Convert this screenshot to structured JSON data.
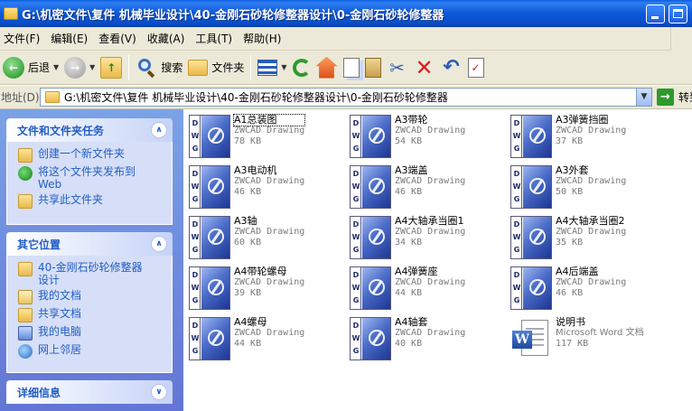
{
  "window": {
    "title": "G:\\机密文件\\复件 机械毕业设计\\40-金刚石砂轮修整器设计\\0-金刚石砂轮修整器"
  },
  "menu": [
    {
      "label": "文件(F)"
    },
    {
      "label": "编辑(E)"
    },
    {
      "label": "查看(V)"
    },
    {
      "label": "收藏(A)"
    },
    {
      "label": "工具(T)"
    },
    {
      "label": "帮助(H)"
    }
  ],
  "toolbar": {
    "back_label": "后退",
    "search_label": "搜索",
    "folders_label": "文件夹"
  },
  "address": {
    "label": "地址(D)",
    "value": "G:\\机密文件\\复件 机械毕业设计\\40-金刚石砂轮修整器设计\\0-金刚石砂轮修整器",
    "go_label": "转到"
  },
  "tasks_panel": {
    "title": "文件和文件夹任务",
    "items": [
      {
        "label": "创建一个新文件夹",
        "icon": "new-folder-icon"
      },
      {
        "label": "将这个文件夹发布到 Web",
        "icon": "web-publish-icon"
      },
      {
        "label": "共享此文件夹",
        "icon": "share-folder-icon"
      }
    ]
  },
  "places_panel": {
    "title": "其它位置",
    "items": [
      {
        "label": "40-金刚石砂轮修整器设计",
        "icon": "folder-icon"
      },
      {
        "label": "我的文档",
        "icon": "my-documents-icon"
      },
      {
        "label": "共享文档",
        "icon": "shared-documents-icon"
      },
      {
        "label": "我的电脑",
        "icon": "my-computer-icon"
      },
      {
        "label": "网上邻居",
        "icon": "network-places-icon"
      }
    ]
  },
  "details_panel": {
    "title": "详细信息"
  },
  "files": [
    {
      "name": "A1总装图",
      "type": "ZWCAD Drawing",
      "size": "78 KB",
      "icon": "dwg-icon",
      "selected": true
    },
    {
      "name": "A3带轮",
      "type": "ZWCAD Drawing",
      "size": "54 KB",
      "icon": "dwg-icon"
    },
    {
      "name": "A3弹簧挡圈",
      "type": "ZWCAD Drawing",
      "size": "37 KB",
      "icon": "dwg-icon"
    },
    {
      "name": "A3电动机",
      "type": "ZWCAD Drawing",
      "size": "46 KB",
      "icon": "dwg-icon"
    },
    {
      "name": "A3端盖",
      "type": "ZWCAD Drawing",
      "size": "46 KB",
      "icon": "dwg-icon"
    },
    {
      "name": "A3外套",
      "type": "ZWCAD Drawing",
      "size": "50 KB",
      "icon": "dwg-icon"
    },
    {
      "name": "A3轴",
      "type": "ZWCAD Drawing",
      "size": "60 KB",
      "icon": "dwg-icon"
    },
    {
      "name": "A4大轴承当圈1",
      "type": "ZWCAD Drawing",
      "size": "34 KB",
      "icon": "dwg-icon"
    },
    {
      "name": "A4大轴承当圈2",
      "type": "ZWCAD Drawing",
      "size": "35 KB",
      "icon": "dwg-icon"
    },
    {
      "name": "A4带轮螺母",
      "type": "ZWCAD Drawing",
      "size": "39 KB",
      "icon": "dwg-icon"
    },
    {
      "name": "A4弹簧座",
      "type": "ZWCAD Drawing",
      "size": "44 KB",
      "icon": "dwg-icon"
    },
    {
      "name": "A4后端盖",
      "type": "ZWCAD Drawing",
      "size": "46 KB",
      "icon": "dwg-icon"
    },
    {
      "name": "A4螺母",
      "type": "ZWCAD Drawing",
      "size": "44 KB",
      "icon": "dwg-icon"
    },
    {
      "name": "A4轴套",
      "type": "ZWCAD Drawing",
      "size": "40 KB",
      "icon": "dwg-icon"
    },
    {
      "name": "说明书",
      "type": "Microsoft Word 文档",
      "size": "117 KB",
      "icon": "word-doc-icon"
    }
  ]
}
